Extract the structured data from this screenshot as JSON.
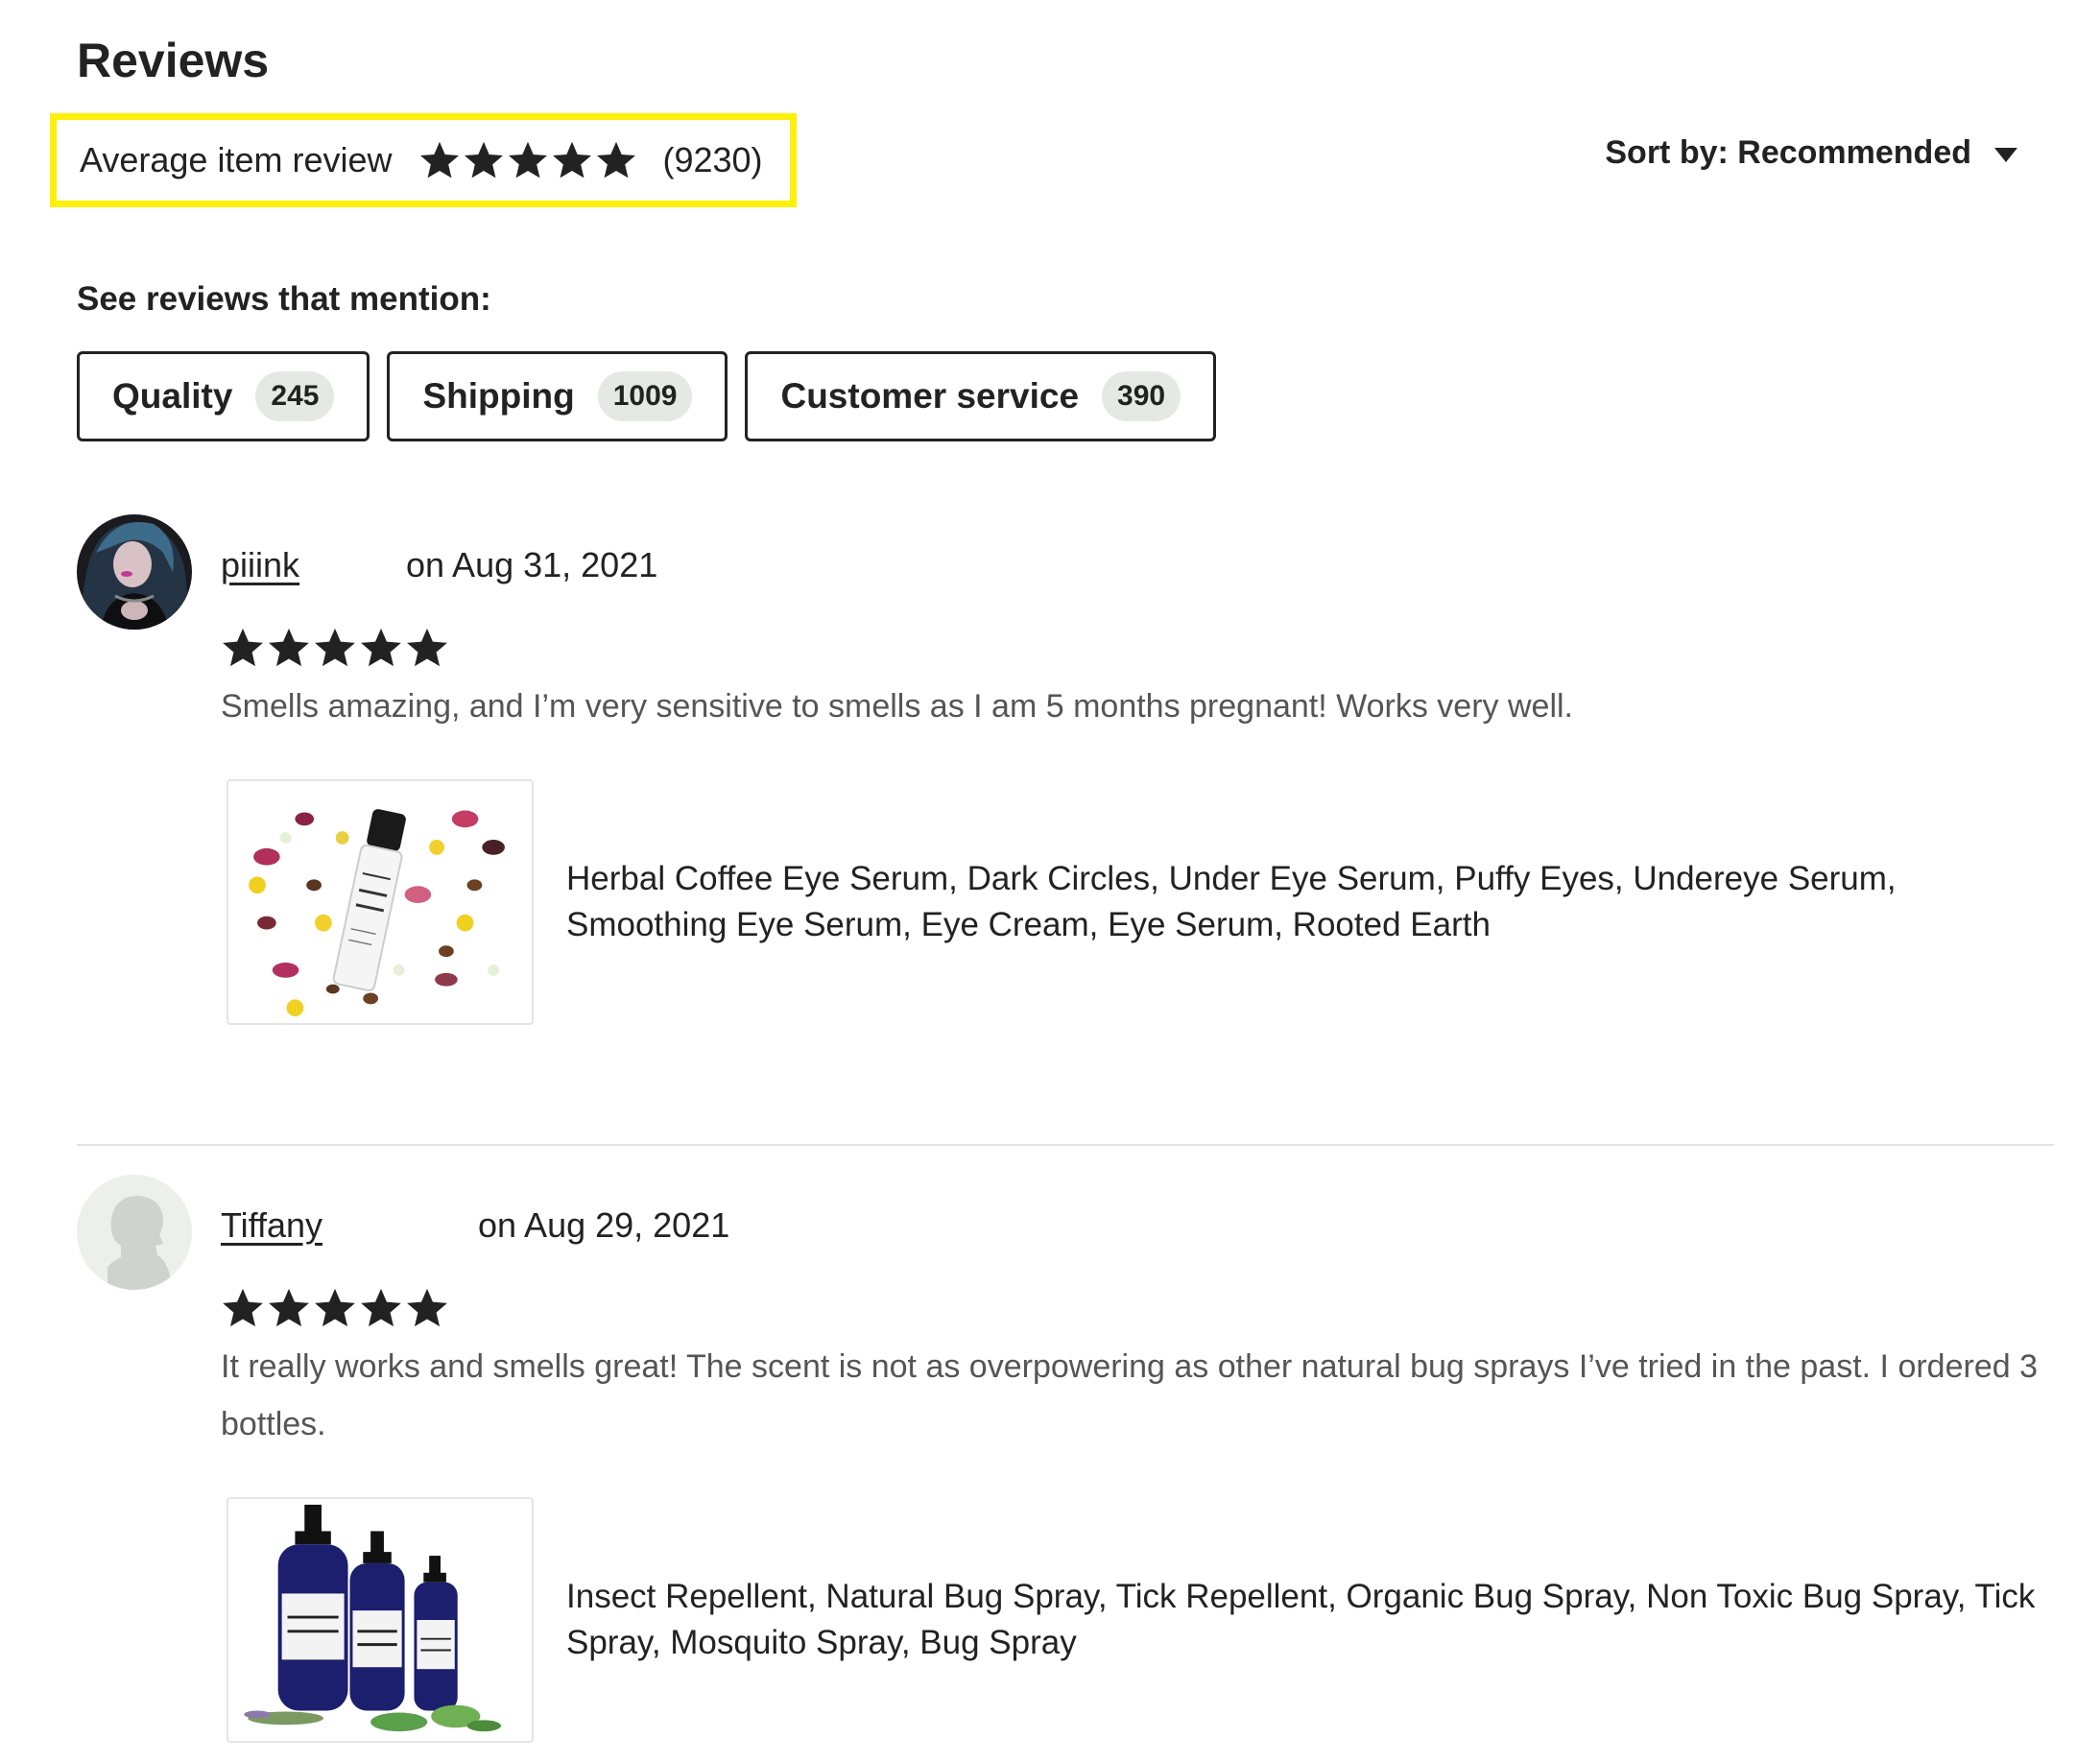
{
  "header": {
    "title": "Reviews",
    "avg_label": "Average item review",
    "avg_rating": 5,
    "avg_count": "(9230)",
    "sort_label": "Sort by: Recommended",
    "highlight_color": "#fdf00a"
  },
  "mentions": {
    "title": "See reviews that mention:",
    "chips": [
      {
        "label": "Quality",
        "count": "245"
      },
      {
        "label": "Shipping",
        "count": "1009"
      },
      {
        "label": "Customer service",
        "count": "390"
      }
    ]
  },
  "reviews": [
    {
      "reviewer": "piiink",
      "date": "on Aug 31, 2021",
      "rating": 5,
      "text": "Smells amazing, and I’m very sensitive to smells as I am 5 months pregnant! Works very well.",
      "product_title": "Herbal Coffee Eye Serum, Dark Circles, Under Eye Serum, Puffy Eyes, Undereye Serum, Smoothing Eye Serum, Eye Cream, Eye Serum, Rooted Earth",
      "avatar_icon": "user-photo-avatar",
      "product_image_icon": "eye-serum-roller-bottle-with-flowers"
    },
    {
      "reviewer": "Tiffany",
      "date": "on Aug 29, 2021",
      "rating": 5,
      "text": "It really works and smells great! The scent is not as overpowering as other natural bug sprays I’ve tried in the past. I ordered 3 bottles.",
      "product_title": "Insect Repellent, Natural Bug Spray, Tick Repellent, Organic Bug Spray, Non Toxic Bug Spray, Tick Spray, Mosquito Spray, Bug Spray",
      "avatar_icon": "default-silhouette-avatar",
      "product_image_icon": "insect-repellent-spray-bottles"
    }
  ]
}
